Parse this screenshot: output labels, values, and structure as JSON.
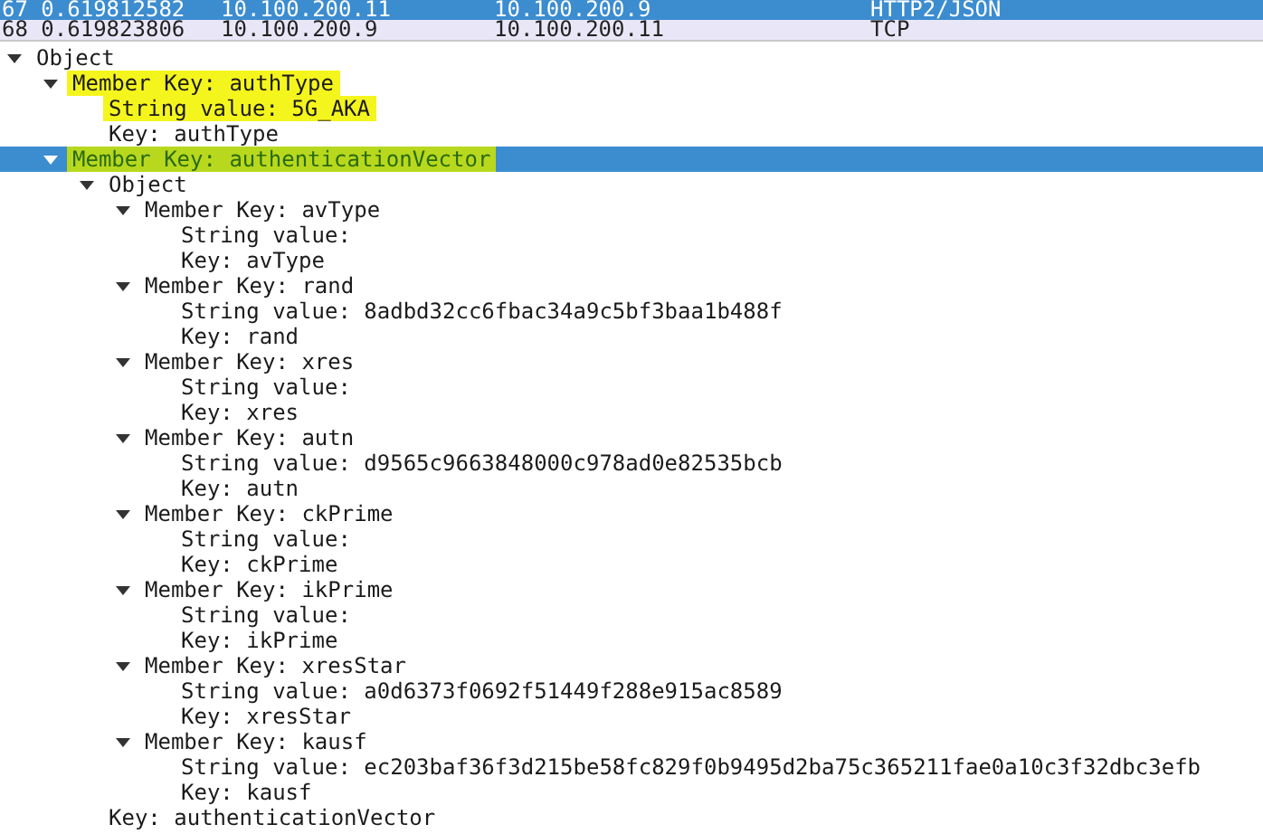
{
  "packet_list": {
    "rows": [
      {
        "number_time": "67 0.619812582",
        "source": "10.100.200.11",
        "destination": "10.100.200.9",
        "protocol": "HTTP2/JSON",
        "selected": true
      },
      {
        "number_time": "68 0.619823806",
        "source": "10.100.200.9",
        "destination": "10.100.200.11",
        "protocol": "TCP",
        "selected": false
      }
    ]
  },
  "tree": [
    {
      "text": "Object",
      "expanded": true,
      "selected": false,
      "highlighted": false,
      "children": [
        {
          "text": "Member Key: authType",
          "expanded": true,
          "selected": false,
          "highlighted": true,
          "children": [
            {
              "text": "String value: 5G_AKA",
              "selected": false,
              "highlighted": true
            },
            {
              "text": "Key: authType",
              "selected": false,
              "highlighted": false
            }
          ]
        },
        {
          "text": "Member Key: authenticationVector",
          "expanded": true,
          "selected": true,
          "highlighted": true,
          "children": [
            {
              "text": "Object",
              "expanded": true,
              "selected": false,
              "highlighted": false,
              "children": [
                {
                  "text": "Member Key: avType",
                  "expanded": true,
                  "selected": false,
                  "highlighted": false,
                  "children": [
                    {
                      "text": "String value:",
                      "selected": false,
                      "highlighted": false
                    },
                    {
                      "text": "Key: avType",
                      "selected": false,
                      "highlighted": false
                    }
                  ]
                },
                {
                  "text": "Member Key: rand",
                  "expanded": true,
                  "selected": false,
                  "highlighted": false,
                  "children": [
                    {
                      "text": "String value: 8adbd32cc6fbac34a9c5bf3baa1b488f",
                      "selected": false,
                      "highlighted": false
                    },
                    {
                      "text": "Key: rand",
                      "selected": false,
                      "highlighted": false
                    }
                  ]
                },
                {
                  "text": "Member Key: xres",
                  "expanded": true,
                  "selected": false,
                  "highlighted": false,
                  "children": [
                    {
                      "text": "String value:",
                      "selected": false,
                      "highlighted": false
                    },
                    {
                      "text": "Key: xres",
                      "selected": false,
                      "highlighted": false
                    }
                  ]
                },
                {
                  "text": "Member Key: autn",
                  "expanded": true,
                  "selected": false,
                  "highlighted": false,
                  "children": [
                    {
                      "text": "String value: d9565c9663848000c978ad0e82535bcb",
                      "selected": false,
                      "highlighted": false
                    },
                    {
                      "text": "Key: autn",
                      "selected": false,
                      "highlighted": false
                    }
                  ]
                },
                {
                  "text": "Member Key: ckPrime",
                  "expanded": true,
                  "selected": false,
                  "highlighted": false,
                  "children": [
                    {
                      "text": "String value:",
                      "selected": false,
                      "highlighted": false
                    },
                    {
                      "text": "Key: ckPrime",
                      "selected": false,
                      "highlighted": false
                    }
                  ]
                },
                {
                  "text": "Member Key: ikPrime",
                  "expanded": true,
                  "selected": false,
                  "highlighted": false,
                  "children": [
                    {
                      "text": "String value:",
                      "selected": false,
                      "highlighted": false
                    },
                    {
                      "text": "Key: ikPrime",
                      "selected": false,
                      "highlighted": false
                    }
                  ]
                },
                {
                  "text": "Member Key: xresStar",
                  "expanded": true,
                  "selected": false,
                  "highlighted": false,
                  "children": [
                    {
                      "text": "String value: a0d6373f0692f51449f288e915ac8589",
                      "selected": false,
                      "highlighted": false
                    },
                    {
                      "text": "Key: xresStar",
                      "selected": false,
                      "highlighted": false
                    }
                  ]
                },
                {
                  "text": "Member Key: kausf",
                  "expanded": true,
                  "selected": false,
                  "highlighted": false,
                  "children": [
                    {
                      "text": "String value: ec203baf36f3d215be58fc829f0b9495d2ba75c365211fae0a10c3f32dbc3efb",
                      "selected": false,
                      "highlighted": false
                    },
                    {
                      "text": "Key: kausf",
                      "selected": false,
                      "highlighted": false
                    }
                  ]
                }
              ]
            },
            {
              "text": "Key: authenticationVector",
              "selected": false,
              "highlighted": false
            }
          ]
        }
      ]
    }
  ]
}
